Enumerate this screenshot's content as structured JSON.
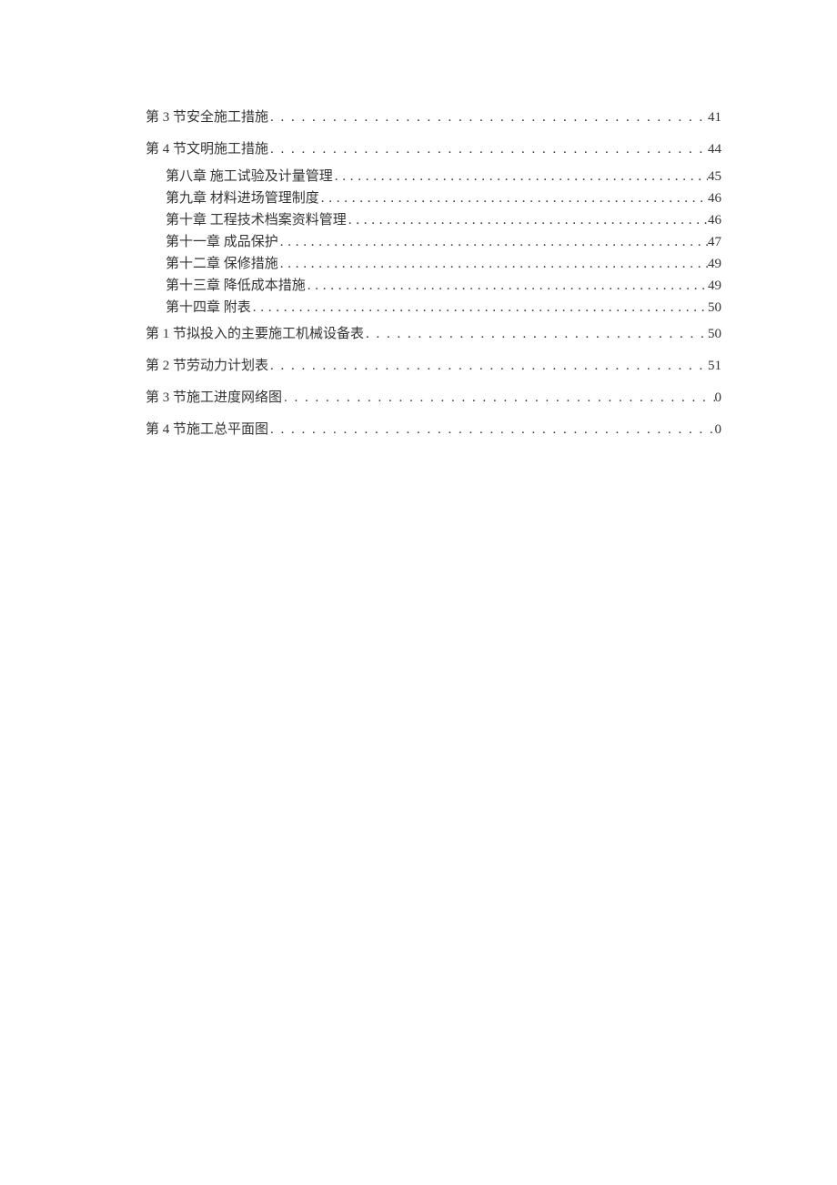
{
  "entries": [
    {
      "type": "section",
      "title": "第 3 节安全施工措施",
      "page": "41"
    },
    {
      "type": "section",
      "title": "第 4 节文明施工措施",
      "page": "44"
    },
    {
      "type": "chapter",
      "title": "第八章  施工试验及计量管理",
      "page": "45"
    },
    {
      "type": "chapter",
      "title": "第九章  材料进场管理制度",
      "page": "46"
    },
    {
      "type": "chapter",
      "title": "第十章  工程技术档案资料管理",
      "page": "46"
    },
    {
      "type": "chapter",
      "title": "第十一章  成品保护",
      "page": "47"
    },
    {
      "type": "chapter",
      "title": "第十二章  保修措施",
      "page": "49"
    },
    {
      "type": "chapter",
      "title": "第十三章  降低成本措施",
      "page": "49"
    },
    {
      "type": "chapter",
      "title": "第十四章  附表",
      "page": "50"
    },
    {
      "type": "section",
      "title": "第 1 节拟投入的主要施工机械设备表",
      "page": "50"
    },
    {
      "type": "section",
      "title": "第 2 节劳动力计划表",
      "page": "51"
    },
    {
      "type": "section",
      "title": "第 3 节施工进度网络图",
      "page": "0"
    },
    {
      "type": "section",
      "title": "第 4 节施工总平面图",
      "page": "0"
    }
  ],
  "dots_fill": ". . . . . . . . . . . . . . . . . . . . . . . . . . . . . . . . . . . . . . . . . . . . . . . . . . . . . . . . . . . . . . . . . . . . . . . . . . . . . . . . . . . . . . . . . . . . . . . . . . . . . . . . . . . . . . . . . . . . . . . . . . . . . . . . . . . . . . . . . . . . . . . . . . . . . . . . . . . . . . . . . . . . . . . . . . . . . . . . . . . . . . . . . . . . . . . . . . . .",
  "dots_fill_chapter": ". . . . . . . . . . . . . . . . . . . . . . . . . . . . . . . . . . . . . . . . . . . . . . . . . . . . . . . . . . . . . . . . . . . . . . . . . . . . . . . . . . . . . . . . . . . . . . . . . . . . . . . . . . . . . . . . . . . . . . . . . . . . . . . . . . . . . . . . . . . . . . . . . . . . . . . . . . . . . . . . . . . . . . . . . . . . . . . . . . . . . . . . . . . . . . . . . . . . . . . . . . . . . . . . . . . . . . . . . . . . . . . . . . . . . . . . . . . . . . . . . . . . . . . . . . . . . . . . . . . . . . . . . . . . . . . . . . . . . . . . . . . . . . . . . . . ."
}
